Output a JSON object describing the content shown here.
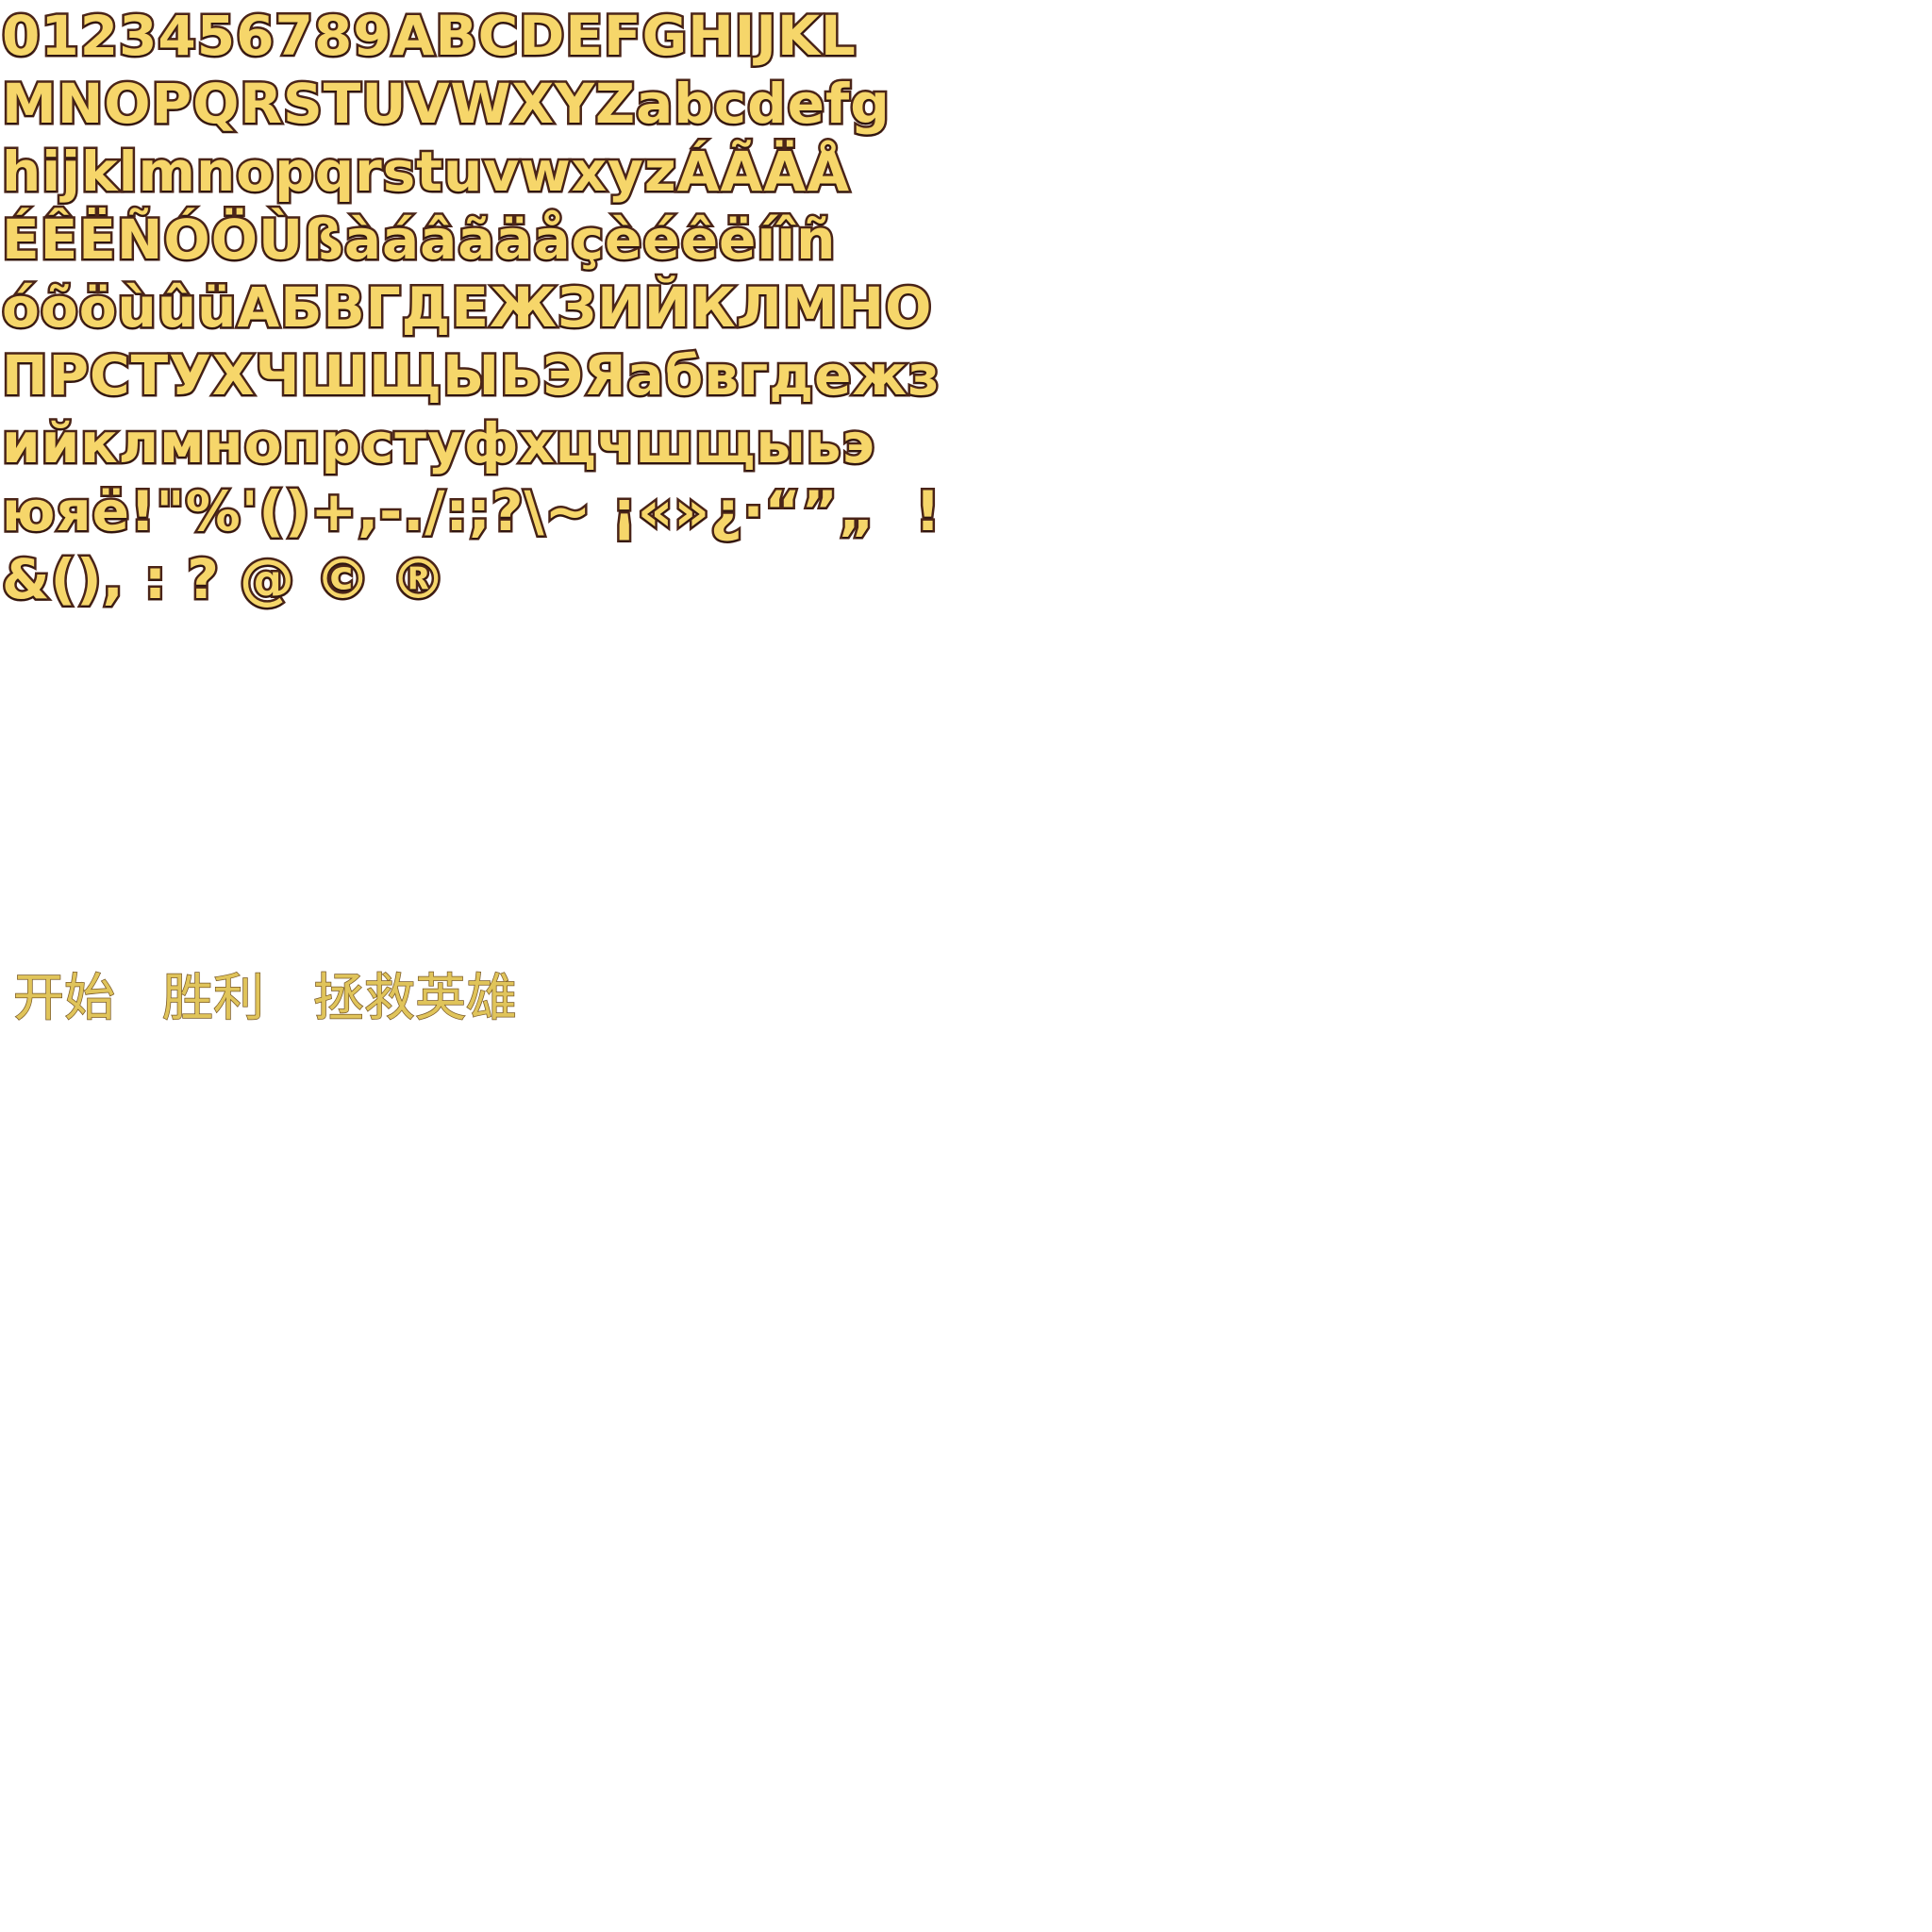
{
  "atlas": {
    "rows": [
      "0123456789ABCDEFGHIJKL",
      "MNOPQRSTUVWXYZabcdefg",
      "hijklmnopqrstuvwxyzÁÃÄÅ",
      "ÉÊËÑÓÖÙßàáâãäåçèéêëíîñ",
      "óõöùûüАБВГДЕЖЗИЙКЛМНО",
      "ПРСТУХЧШЩЫЬЭЯабвгдежз",
      "ийклмнопрстуфхцчшщыьэ",
      "юяё!\"%'()+,-./:;?\\~ ¡«»¿·“”„  !",
      "&(), : ? @ © ®"
    ],
    "fill_color": "#f6d66a",
    "outline_color": "#4a2418"
  },
  "labels": {
    "start": "开始",
    "victory": "胜利",
    "rescue_hero": "拯救英雄",
    "color": "#e0c45a"
  }
}
